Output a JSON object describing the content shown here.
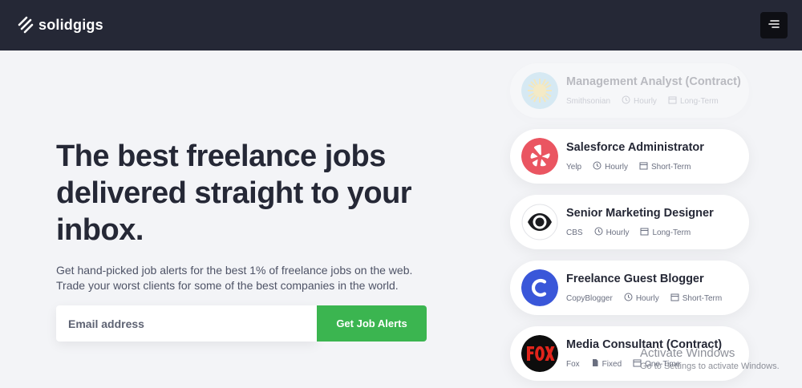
{
  "header": {
    "brand": "solidgigs",
    "menu_icon": "hamburger-icon"
  },
  "hero": {
    "headline": "The best freelance jobs delivered straight to your inbox.",
    "subtext": "Get hand-picked job alerts for the best 1% of freelance jobs on the web. Trade your worst clients for some of the best companies in the world.",
    "email_placeholder": "Email address",
    "cta_label": "Get Job Alerts"
  },
  "jobs": [
    {
      "title": "Management Analyst (Contract)",
      "company": "Smithsonian",
      "rate_type": "Hourly",
      "rate_icon": "clock-icon",
      "term": "Long-Term",
      "logo": "smithsonian-sun-logo"
    },
    {
      "title": "Salesforce Administrator",
      "company": "Yelp",
      "rate_type": "Hourly",
      "rate_icon": "clock-icon",
      "term": "Short-Term",
      "logo": "yelp-logo"
    },
    {
      "title": "Senior Marketing Designer",
      "company": "CBS",
      "rate_type": "Hourly",
      "rate_icon": "clock-icon",
      "term": "Long-Term",
      "logo": "cbs-eye-logo"
    },
    {
      "title": "Freelance Guest Blogger",
      "company": "CopyBlogger",
      "rate_type": "Hourly",
      "rate_icon": "clock-icon",
      "term": "Short-Term",
      "logo": "copyblogger-logo"
    },
    {
      "title": "Media Consultant (Contract)",
      "company": "Fox",
      "rate_type": "Fixed",
      "rate_icon": "file-icon",
      "term": "One-Time",
      "logo": "fox-logo"
    }
  ],
  "watermark": {
    "line1": "Activate Windows",
    "line2": "Go to Settings to activate Windows."
  },
  "colors": {
    "header_bg": "#252836",
    "cta": "#3bb550",
    "page_bg": "#f3f4f7"
  }
}
